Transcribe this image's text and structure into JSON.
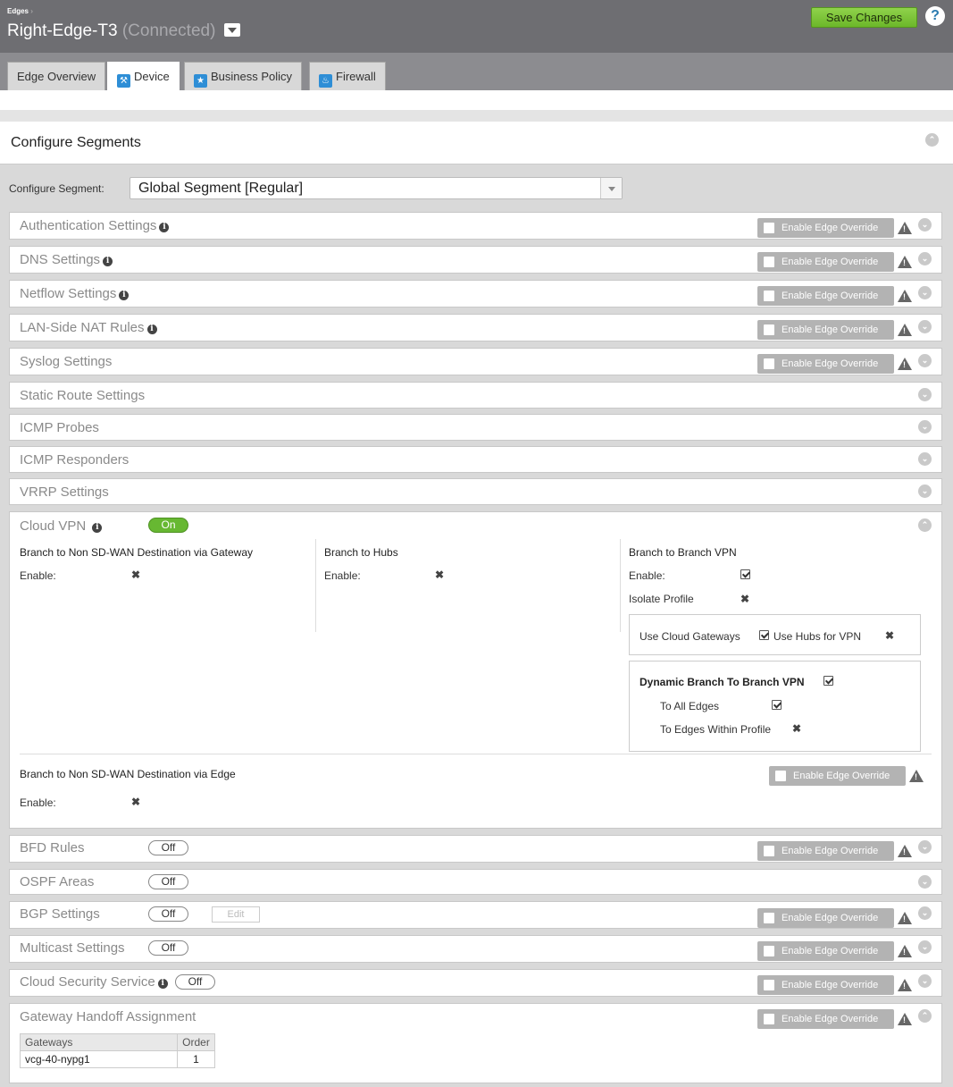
{
  "header": {
    "breadcrumb": "Edges",
    "breadcrumb_sep": "›",
    "edge_name": "Right-Edge-T3",
    "edge_status": "(Connected)",
    "save_label": "Save Changes",
    "help_label": "?"
  },
  "tabs": [
    {
      "label": "Edge Overview",
      "icon": ""
    },
    {
      "label": "Device",
      "icon": "wrench-icon"
    },
    {
      "label": "Business Policy",
      "icon": "ribbon-icon"
    },
    {
      "label": "Firewall",
      "icon": "flame-icon"
    }
  ],
  "configure": {
    "title": "Configure Segments",
    "segment_label": "Configure Segment:",
    "segment_value": "Global Segment [Regular]"
  },
  "override_label": "Enable Edge Override",
  "sections": {
    "auth": "Authentication Settings",
    "dns": "DNS Settings",
    "netflow": "Netflow Settings",
    "lannat": "LAN-Side NAT Rules",
    "syslog": "Syslog Settings",
    "static_route": "Static Route Settings",
    "icmp_probes": "ICMP Probes",
    "icmp_responders": "ICMP Responders",
    "vrrp": "VRRP Settings",
    "cloud_vpn": "Cloud VPN",
    "bfd": "BFD Rules",
    "ospf": "OSPF Areas",
    "bgp": "BGP Settings",
    "multicast": "Multicast Settings",
    "css": "Cloud Security Service",
    "gateway_handoff": "Gateway Handoff Assignment"
  },
  "toggles": {
    "cloud_vpn": "On",
    "bfd": "Off",
    "ospf": "Off",
    "bgp": "Off",
    "multicast": "Off",
    "css": "Off"
  },
  "bgp_edit_label": "Edit",
  "cloud_vpn": {
    "col1_title": "Branch to Non SD-WAN Destination via Gateway",
    "col1_enable_label": "Enable:",
    "col2_title": "Branch to Hubs",
    "col2_enable_label": "Enable:",
    "col3_title": "Branch to Branch VPN",
    "col3_enable_label": "Enable:",
    "isolate_label": "Isolate Profile",
    "use_cloud_gateways": "Use Cloud Gateways",
    "use_hubs_for_vpn": "Use Hubs for VPN",
    "dynamic_title": "Dynamic Branch To Branch VPN",
    "to_all_edges": "To All Edges",
    "to_edges_within_profile": "To Edges Within Profile",
    "via_edge_title": "Branch to Non SD-WAN Destination via Edge",
    "via_edge_enable_label": "Enable:"
  },
  "gateway_table": {
    "headers": [
      "Gateways",
      "Order"
    ],
    "rows": [
      [
        "vcg-40-nypg1",
        "1"
      ]
    ]
  },
  "colors": {
    "save_green": "#6cb72a",
    "toggle_on": "#67b832",
    "header_gray": "#6e6e72"
  }
}
